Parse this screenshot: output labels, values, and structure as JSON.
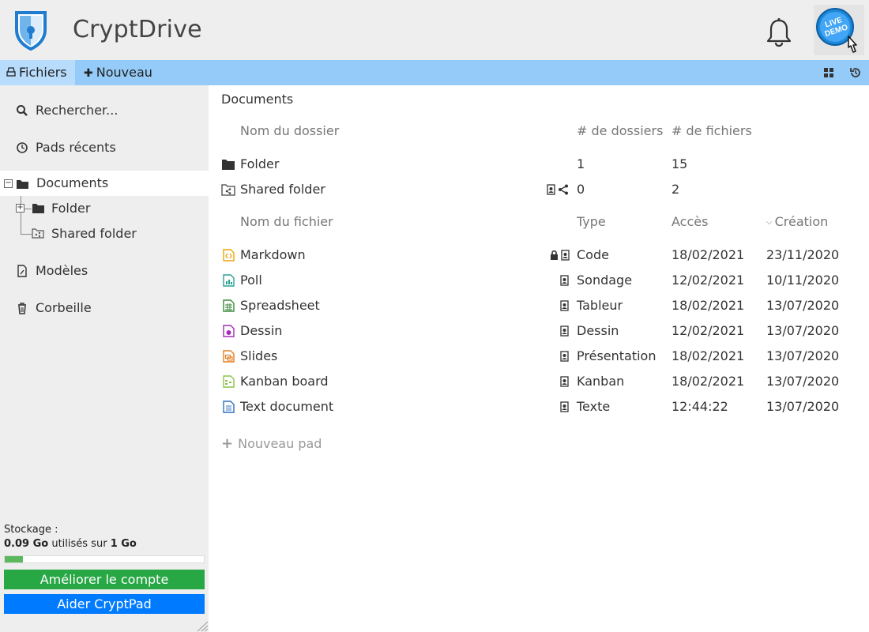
{
  "app": {
    "title": "CryptDrive"
  },
  "toolbar": {
    "files_label": "Fichiers",
    "new_label": "Nouveau"
  },
  "sidebar": {
    "search_label": "Rechercher...",
    "recent_label": "Pads récents",
    "documents_label": "Documents",
    "tree": [
      "Folder",
      "Shared folder"
    ],
    "templates_label": "Modèles",
    "trash_label": "Corbeille",
    "storage_label": "Stockage :",
    "storage_used": "0.09 Go",
    "storage_used_of": " utilisés sur ",
    "storage_total": "1 Go",
    "storage_fraction": 0.09,
    "upgrade_label": "Améliorer le compte",
    "donate_label": "Aider CryptPad"
  },
  "main": {
    "path": "Documents",
    "folder_headers": {
      "name": "Nom du dossier",
      "folders": "# de dossiers",
      "files": "# de fichiers"
    },
    "folders": [
      {
        "name": "Folder",
        "folders": "1",
        "files": "15",
        "icon": "folder-icon"
      },
      {
        "name": "Shared folder",
        "folders": "0",
        "files": "2",
        "icon": "shared-folder-icon"
      }
    ],
    "file_headers": {
      "name": "Nom du fichier",
      "type": "Type",
      "access": "Accès",
      "created": "Création"
    },
    "files": [
      {
        "name": "Markdown",
        "type": "Code",
        "access": "18/02/2021",
        "created": "23/11/2020",
        "icon": "code-file-icon",
        "color": "#f0a30a"
      },
      {
        "name": "Poll",
        "type": "Sondage",
        "access": "12/02/2021",
        "created": "10/11/2020",
        "icon": "poll-file-icon",
        "color": "#2aa198"
      },
      {
        "name": "Spreadsheet",
        "type": "Tableur",
        "access": "18/02/2021",
        "created": "13/07/2020",
        "icon": "spreadsheet-file-icon",
        "color": "#3c8a3c"
      },
      {
        "name": "Dessin",
        "type": "Dessin",
        "access": "12/02/2021",
        "created": "13/07/2020",
        "icon": "drawing-file-icon",
        "color": "#a52ab8"
      },
      {
        "name": "Slides",
        "type": "Présentation",
        "access": "18/02/2021",
        "created": "13/07/2020",
        "icon": "slides-file-icon",
        "color": "#e67e22"
      },
      {
        "name": "Kanban board",
        "type": "Kanban",
        "access": "18/02/2021",
        "created": "13/07/2020",
        "icon": "kanban-file-icon",
        "color": "#8bc34a"
      },
      {
        "name": "Text document",
        "type": "Texte",
        "access": "12:44:22",
        "created": "13/07/2020",
        "icon": "text-file-icon",
        "color": "#2d6fc0"
      }
    ],
    "new_pad_label": "Nouveau pad"
  },
  "colors": {
    "topbar": "#eeeeee",
    "toolbar": "#94cbf8",
    "upgrade": "#28a745",
    "donate": "#007bff",
    "storage_fill": "#5cb85c"
  }
}
